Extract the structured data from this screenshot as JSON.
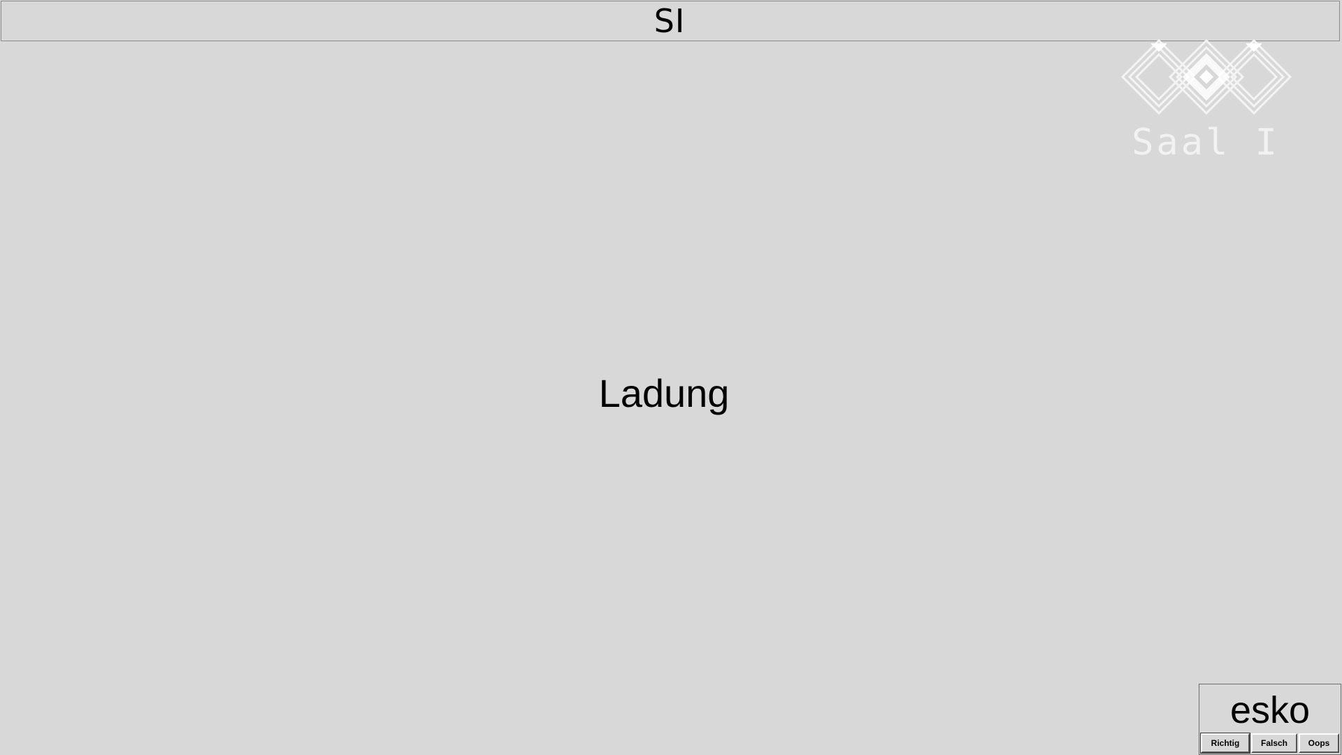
{
  "header": {
    "title": "SI"
  },
  "logo": {
    "icon": "diamond-knot-logo-icon",
    "label": "Saal I",
    "color": "#f2f2f2"
  },
  "main": {
    "word": "Ladung"
  },
  "player": {
    "name": "esko",
    "buttons": {
      "correct": "Richtig",
      "wrong": "Falsch",
      "oops": "Oops"
    }
  },
  "colors": {
    "background": "#d8d8d8",
    "text": "#000000"
  }
}
